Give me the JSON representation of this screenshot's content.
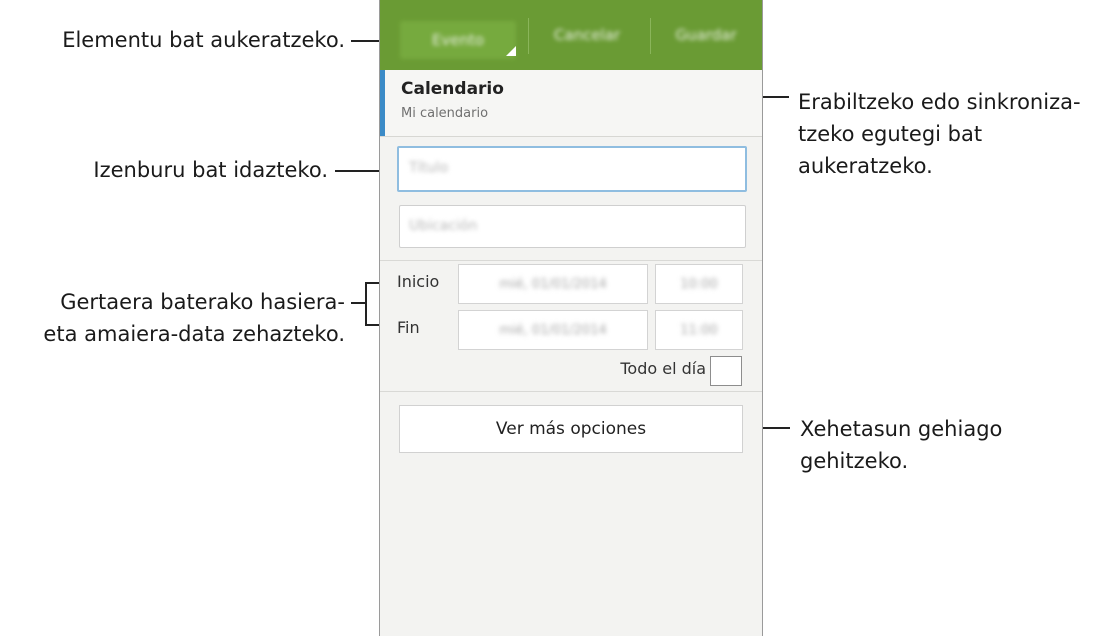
{
  "annotations": {
    "select_item": "Elementu bat aukeratzeko.",
    "title": "Izenburu bat idazteko.",
    "datetime": [
      "Gertaera baterako hasiera-",
      "eta amaiera-data zehazteko."
    ],
    "calendar": [
      "Erabiltzeko edo sinkroniza-",
      "tzeko egutegi bat",
      "aukeratzeko."
    ],
    "details": [
      "Xehetasun gehiago",
      "gehitzeko."
    ]
  },
  "screen": {
    "actionbar": {
      "spinner_label": "Evento",
      "cancel_label": "Cancelar",
      "save_label": "Guardar"
    },
    "calendar": {
      "title": "Calendario",
      "subtitle": "Mi calendario"
    },
    "title_placeholder": "Título",
    "location_placeholder": "Ubicación",
    "start": {
      "label": "Inicio",
      "date": "mié, 01/01/2014",
      "time": "10:00"
    },
    "end": {
      "label": "Fin",
      "date": "mié, 01/01/2014",
      "time": "11:00"
    },
    "all_day_label": "Todo el día",
    "all_day_checked": false,
    "more_options_label": "Ver más opciones"
  },
  "colors": {
    "actionbar": "#6a9b34",
    "accent": "#3b8bc7",
    "focus_border": "#8fbde0"
  }
}
